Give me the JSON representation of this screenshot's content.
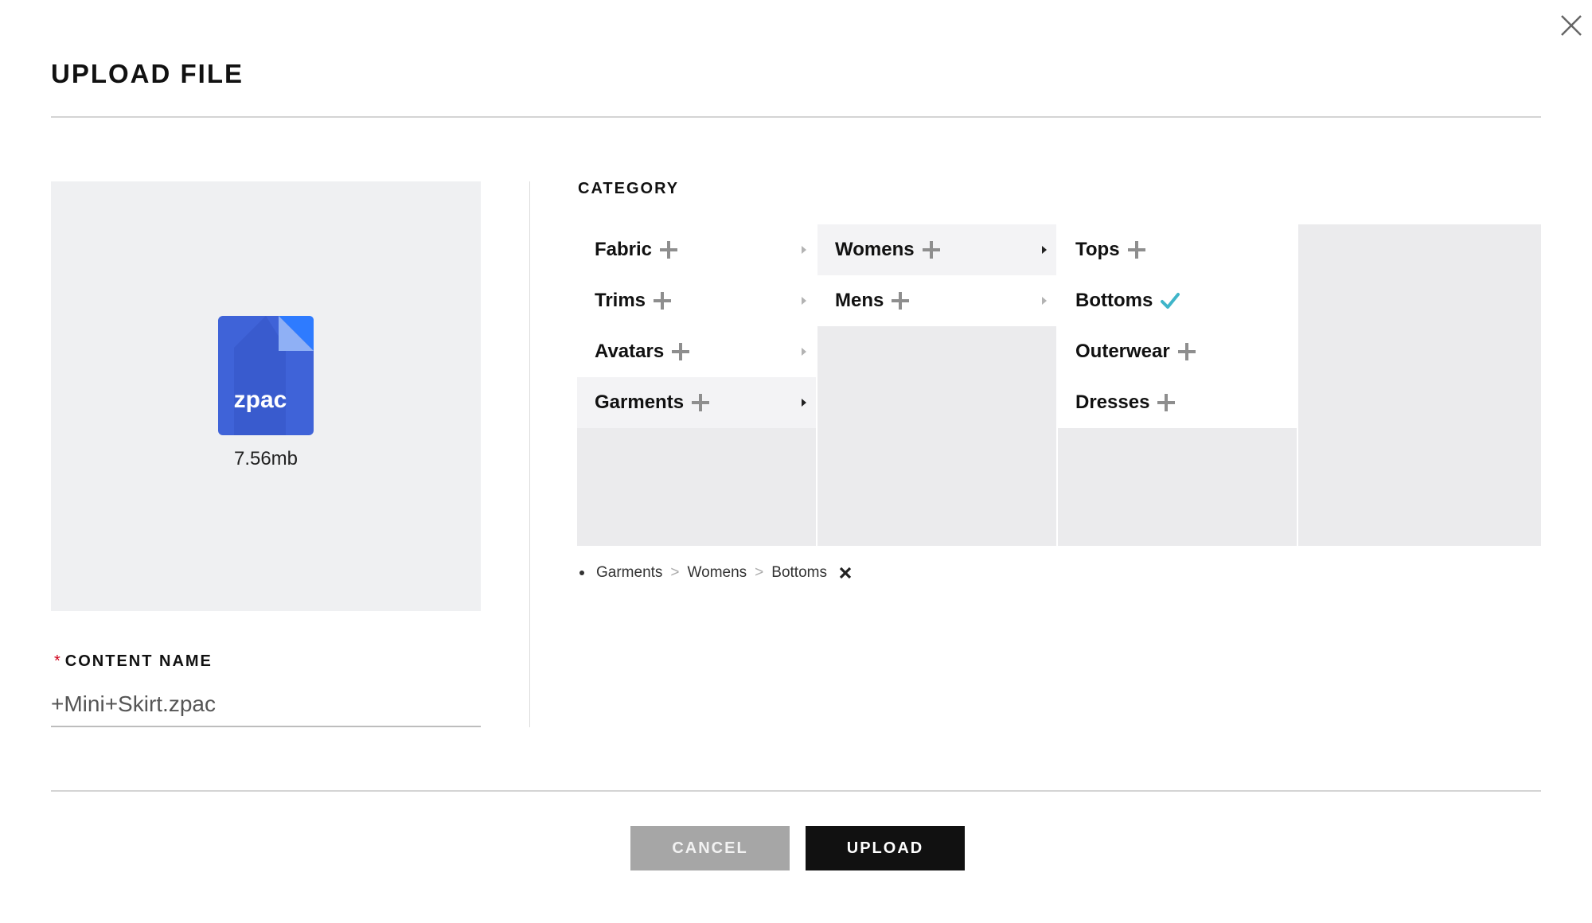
{
  "dialog": {
    "title": "UPLOAD FILE",
    "close_icon": "close-icon"
  },
  "preview": {
    "file_ext": "zpac",
    "file_size": "7.56mb",
    "icon_color": "#3f63d8",
    "icon_corner_color": "#2e7bff"
  },
  "content_name": {
    "required_mark": "*",
    "label": "CONTENT NAME",
    "value": "+Mini+Skirt.zpac"
  },
  "category": {
    "label": "CATEGORY",
    "columns": [
      {
        "items": [
          {
            "label": "Fabric"
          },
          {
            "label": "Trims"
          },
          {
            "label": "Avatars"
          },
          {
            "label": "Garments",
            "active": true
          }
        ]
      },
      {
        "items": [
          {
            "label": "Womens",
            "active": true
          },
          {
            "label": "Mens"
          }
        ]
      },
      {
        "items": [
          {
            "label": "Tops"
          },
          {
            "label": "Bottoms",
            "selected": true
          },
          {
            "label": "Outerwear"
          },
          {
            "label": "Dresses"
          }
        ]
      }
    ],
    "selected_path": [
      "Garments",
      "Womens",
      "Bottoms"
    ],
    "path_separator": ">",
    "check_color": "#3fb5c9"
  },
  "actions": {
    "cancel_label": "CANCEL",
    "upload_label": "UPLOAD"
  }
}
